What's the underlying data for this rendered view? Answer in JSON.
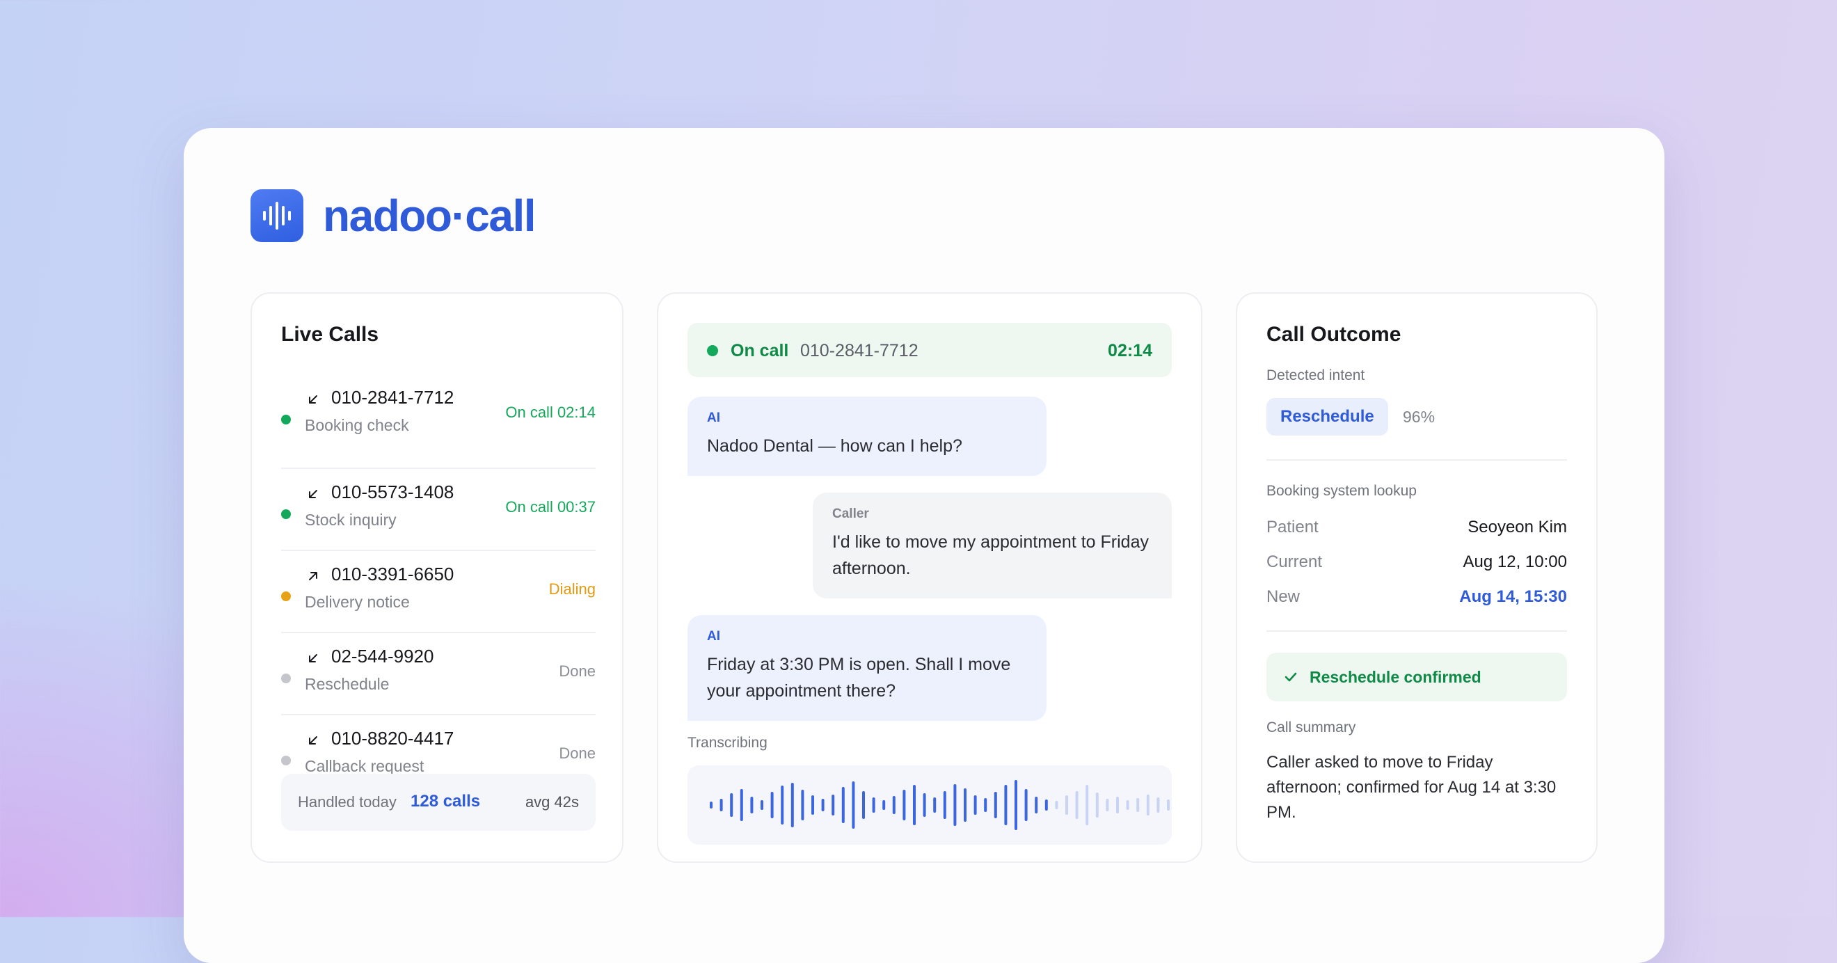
{
  "brand": {
    "name": "nadoo·call",
    "logo_icon": "sound-wave-icon",
    "accent": "#2f5ad8"
  },
  "live_calls": {
    "title": "Live Calls",
    "calls": [
      {
        "number": "010-2841-7712",
        "subtitle": "Booking check",
        "status": "On call 02:14",
        "direction": "incoming",
        "state": "active"
      },
      {
        "number": "010-5573-1408",
        "subtitle": "Stock inquiry",
        "status": "On call 00:37",
        "direction": "incoming",
        "state": "active"
      },
      {
        "number": "010-3391-6650",
        "subtitle": "Delivery notice",
        "status": "Dialing",
        "direction": "outgoing",
        "state": "dialing"
      },
      {
        "number": "02-544-9920",
        "subtitle": "Reschedule",
        "status": "Done",
        "direction": "incoming",
        "state": "done"
      },
      {
        "number": "010-8820-4417",
        "subtitle": "Callback request",
        "status": "Done",
        "direction": "incoming",
        "state": "done"
      }
    ],
    "footer": {
      "label": "Handled today",
      "value": "128 calls",
      "avg": "avg 42s"
    }
  },
  "conversation": {
    "status": {
      "state": "On call",
      "number": "010-2841-7712",
      "time": "02:14"
    },
    "messages": [
      {
        "speaker": "AI",
        "text": "Nadoo Dental — how can I help?"
      },
      {
        "speaker": "Caller",
        "text": "I'd like to move my appointment to Friday afternoon."
      },
      {
        "speaker": "AI",
        "text": "Friday at 3:30 PM is open. Shall I move your appointment there?"
      }
    ],
    "transcribing_label": "Transcribing"
  },
  "outcome": {
    "title": "Call Outcome",
    "intent_label": "Detected intent",
    "intent": "Reschedule",
    "confidence": "96%",
    "lookup_label": "Booking system lookup",
    "lookup": [
      {
        "key": "Patient",
        "value": "Seoyeon Kim"
      },
      {
        "key": "Current",
        "value": "Aug 12, 10:00"
      },
      {
        "key": "New",
        "value": "Aug 14, 15:30"
      }
    ],
    "confirmation": "Reschedule confirmed",
    "summary_label": "Call summary",
    "summary": "Caller asked to move to Friday afternoon; confirmed for Aug 14 at 3:30 PM."
  },
  "colors": {
    "green": "#14a85a",
    "amber": "#e8a21a",
    "gray": "#c4c6cc",
    "blue": "#2f5ad8"
  }
}
